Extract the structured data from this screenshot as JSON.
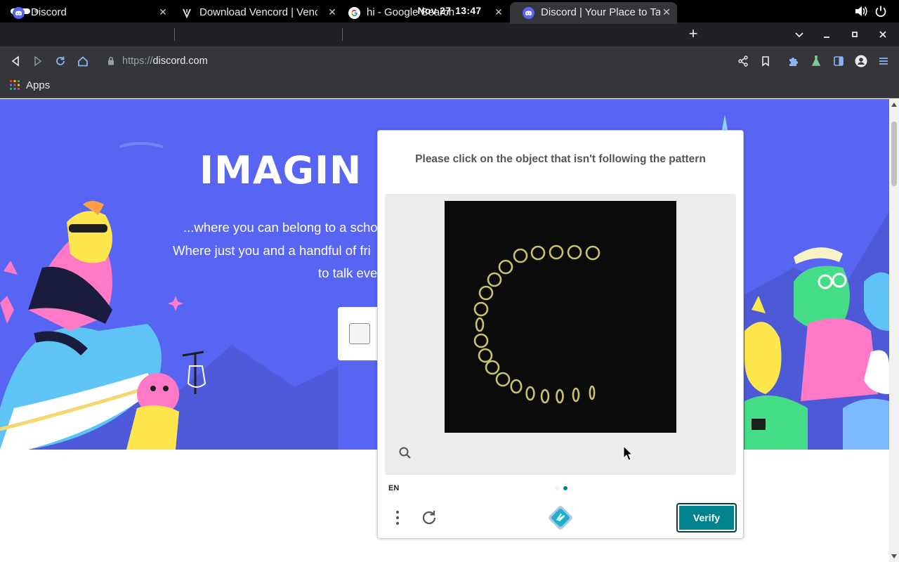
{
  "system": {
    "date": "Nov 27",
    "time": "13:47"
  },
  "tabs": [
    {
      "title": "Discord",
      "favicon": "discord-icon",
      "active": false
    },
    {
      "title": "Download Vencord | Vencord",
      "favicon": "vencord-icon",
      "active": false
    },
    {
      "title": "hi - Google Search",
      "favicon": "google-icon",
      "active": false
    },
    {
      "title": "Discord | Your Place to Talk",
      "favicon": "discord-icon",
      "active": true
    }
  ],
  "address_bar": {
    "scheme": "https://",
    "host": "discord.com"
  },
  "bookmarks": {
    "apps_label": "Apps"
  },
  "hero": {
    "title": "IMAGIN",
    "line1": "...where you can belong to a scho",
    "line2": "Where just you and a handful of fri",
    "line3": "to talk eve"
  },
  "captcha": {
    "prompt": "Please click on the object that isn't following the pattern",
    "language": "EN",
    "verify_label": "Verify",
    "page_indicator": {
      "total": 2,
      "current": 2
    }
  },
  "colors": {
    "hero_bg": "#5865f2",
    "verify_bg": "#00838f",
    "tab_active_bg": "#35363a",
    "chrome_bg": "#202124"
  }
}
